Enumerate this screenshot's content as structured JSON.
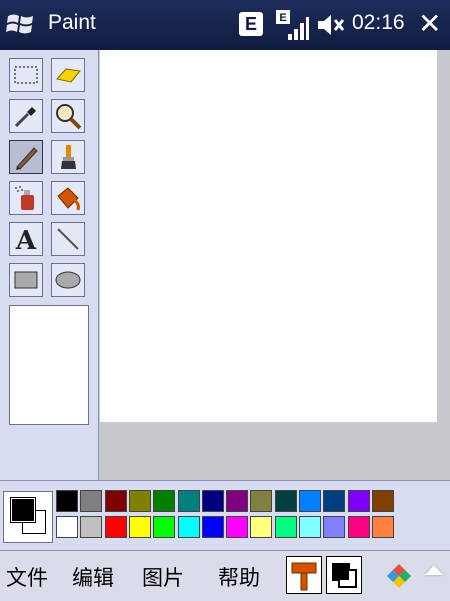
{
  "titlebar": {
    "app_title": "Paint",
    "network_badge": "E",
    "time": "02:16"
  },
  "tools": [
    {
      "name": "rect-select"
    },
    {
      "name": "eraser"
    },
    {
      "name": "color-picker"
    },
    {
      "name": "magnifier"
    },
    {
      "name": "pencil",
      "selected": true
    },
    {
      "name": "brush"
    },
    {
      "name": "airbrush"
    },
    {
      "name": "fill-bucket"
    },
    {
      "name": "text"
    },
    {
      "name": "line"
    },
    {
      "name": "rectangle"
    },
    {
      "name": "ellipse"
    }
  ],
  "palette": {
    "foreground": "#000000",
    "background": "#ffffff",
    "row1": [
      "#000000",
      "#808080",
      "#800000",
      "#808000",
      "#008000",
      "#008080",
      "#000080",
      "#800080",
      "#808040",
      "#004040",
      "#0080ff",
      "#004080",
      "#8000ff",
      "#804000"
    ],
    "row2": [
      "#ffffff",
      "#c0c0c0",
      "#ff0000",
      "#ffff00",
      "#00ff00",
      "#00ffff",
      "#0000ff",
      "#ff00ff",
      "#ffff80",
      "#00ff80",
      "#80ffff",
      "#8080ff",
      "#ff0080",
      "#ff8040"
    ]
  },
  "menu": {
    "file": "文件",
    "edit": "编辑",
    "image": "图片",
    "help": "帮助"
  }
}
